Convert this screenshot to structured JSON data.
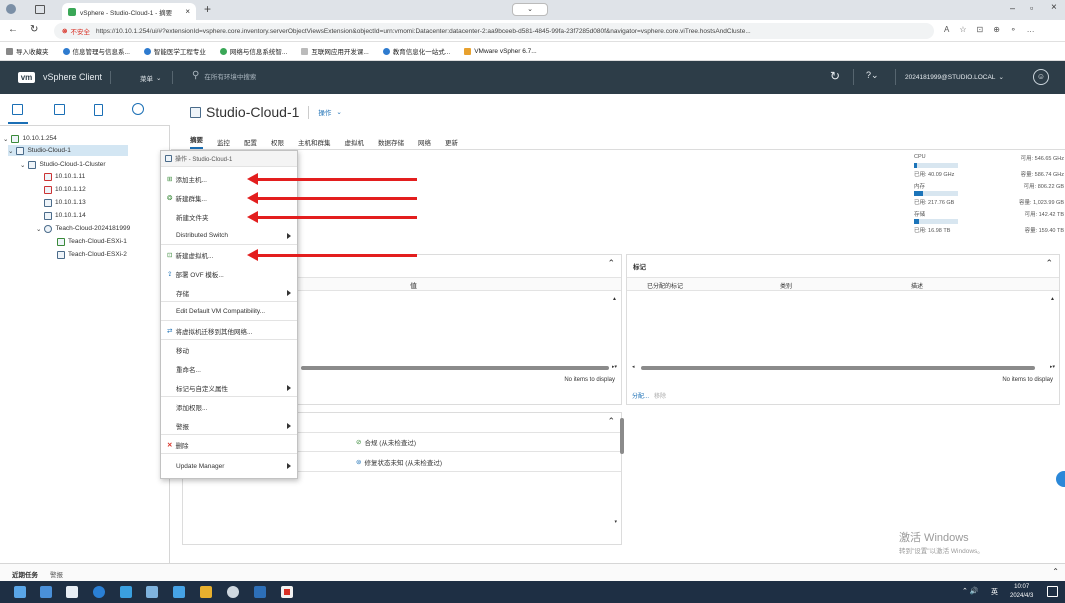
{
  "browser": {
    "tab_title": "vSphere - Studio-Cloud-1 - 摘要",
    "insecure": "不安全",
    "url": "https://10.10.1.254/ui/#?extensionId=vsphere.core.inventory.serverObjectViewsExtension&objectId=urn:vmomi:Datacenter:datacenter-2:aa9bceeb-d581-4845-99fa-23f7285d080f&navigator=vsphere.core.viTree.hostsAndCluste...",
    "bookmarks": [
      "导入收藏夹",
      "信息管理与信息系...",
      "智能医学工程专业",
      "网络与信息系统智...",
      "互联网应用开发课...",
      "教育信息化一站式...",
      "VMware vSpher 6.7..."
    ]
  },
  "header": {
    "logo": "vm",
    "app_name": "vSphere Client",
    "menu": "菜单",
    "search_placeholder": "在所有环境中搜索",
    "user": "2024181999@STUDIO.LOCAL"
  },
  "tree": {
    "root": "10.10.1.254",
    "datacenter": "Studio-Cloud-1",
    "cluster": "Studio-Cloud-1-Cluster",
    "hosts": [
      "10.10.1.11",
      "10.10.1.12",
      "10.10.1.13",
      "10.10.1.14"
    ],
    "vapp": "Teach-Cloud-2024181999",
    "vms": [
      "Teach-Cloud-ESXi-1",
      "Teach-Cloud-ESXi-2"
    ]
  },
  "main": {
    "title": "Studio-Cloud-1",
    "actions": "操作",
    "tabs": [
      "摘要",
      "监控",
      "配置",
      "权限",
      "主机和群集",
      "虚拟机",
      "数据存储",
      "网络",
      "更新"
    ]
  },
  "resources": {
    "cpu_label": "CPU",
    "cpu_free": "可用: 546.65 GHz",
    "cpu_used": "已用: 40.09 GHz",
    "cpu_cap": "容量: 586.74 GHz",
    "cpu_frac": 0.07,
    "mem_label": "内存",
    "mem_free": "可用: 806.22 GB",
    "mem_used": "已用: 217.76 GB",
    "mem_cap": "容量: 1,023.99 GB",
    "mem_frac": 0.21,
    "sto_label": "存储",
    "sto_free": "可用: 142.42 TB",
    "sto_used": "已用: 16.98 TB",
    "sto_cap": "容量: 159.40 TB",
    "sto_frac": 0.11
  },
  "attr_panel": {
    "col_value": "值",
    "empty": "No items to display"
  },
  "tags_panel": {
    "title": "标记",
    "cols": [
      "已分配的标记",
      "类别",
      "描述"
    ],
    "empty": "No items to display",
    "assign": "分配...",
    "remove": "移除"
  },
  "compliance": {
    "row1": "合规 (从未检查过)",
    "row2": "修复状态未知 (从未检查过)"
  },
  "context_menu": {
    "title": "操作 - Studio-Cloud-1",
    "items": [
      "添加主机...",
      "新建群集...",
      "新建文件夹",
      "Distributed Switch",
      "新建虚拟机...",
      "部署 OVF 模板...",
      "存储",
      "Edit Default VM Compatibility...",
      "将虚拟机迁移到其他网络...",
      "移动",
      "重命名...",
      "标记与自定义属性",
      "添加权限...",
      "警报",
      "删除",
      "Update Manager"
    ]
  },
  "bottom": {
    "recent_tasks": "近期任务",
    "alarms": "警报",
    "watermark1": "激活 Windows",
    "watermark2": "转到\"设置\"以激活 Windows。",
    "time": "10:07",
    "date": "2024/4/3",
    "ime": "英"
  }
}
